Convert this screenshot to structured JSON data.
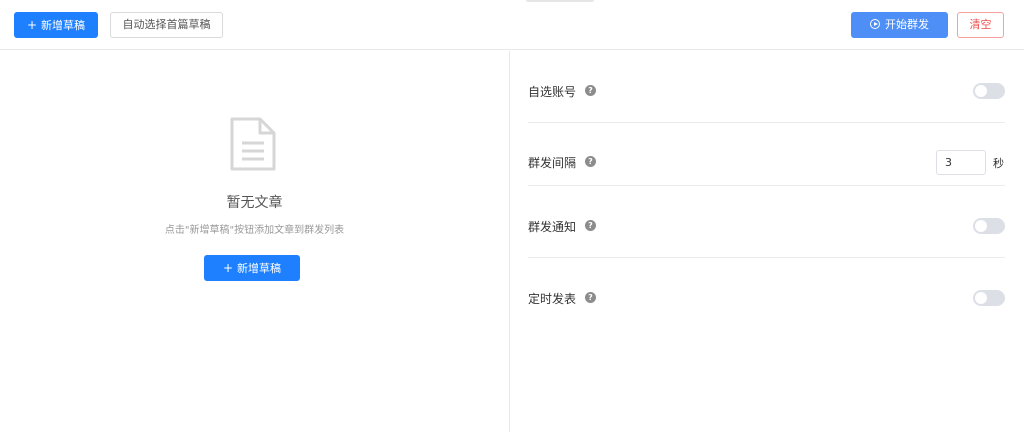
{
  "toolbar": {
    "add_draft_label": "新增草稿",
    "auto_select_label": "自动选择首篇草稿",
    "start_label": "开始群发",
    "clear_label": "清空"
  },
  "empty_state": {
    "title": "暂无文章",
    "hint": "点击\"新增草稿\"按钮添加文章到群发列表",
    "add_button_label": "新增草稿"
  },
  "settings": {
    "auto_account": {
      "label": "自选账号",
      "enabled": false
    },
    "interval": {
      "label": "群发间隔",
      "value": "3",
      "unit": "秒"
    },
    "notify": {
      "label": "群发通知",
      "enabled": false
    },
    "scheduled": {
      "label": "定时发表",
      "enabled": false
    }
  },
  "icons": {
    "add": "plus-icon",
    "start": "play-circle-icon",
    "help": "question-circle-icon",
    "empty": "document-icon"
  },
  "colors": {
    "primary": "#1e80ff",
    "start": "#4d8ff7",
    "danger": "#f05050",
    "toggle_off": "#dcdfe6"
  }
}
